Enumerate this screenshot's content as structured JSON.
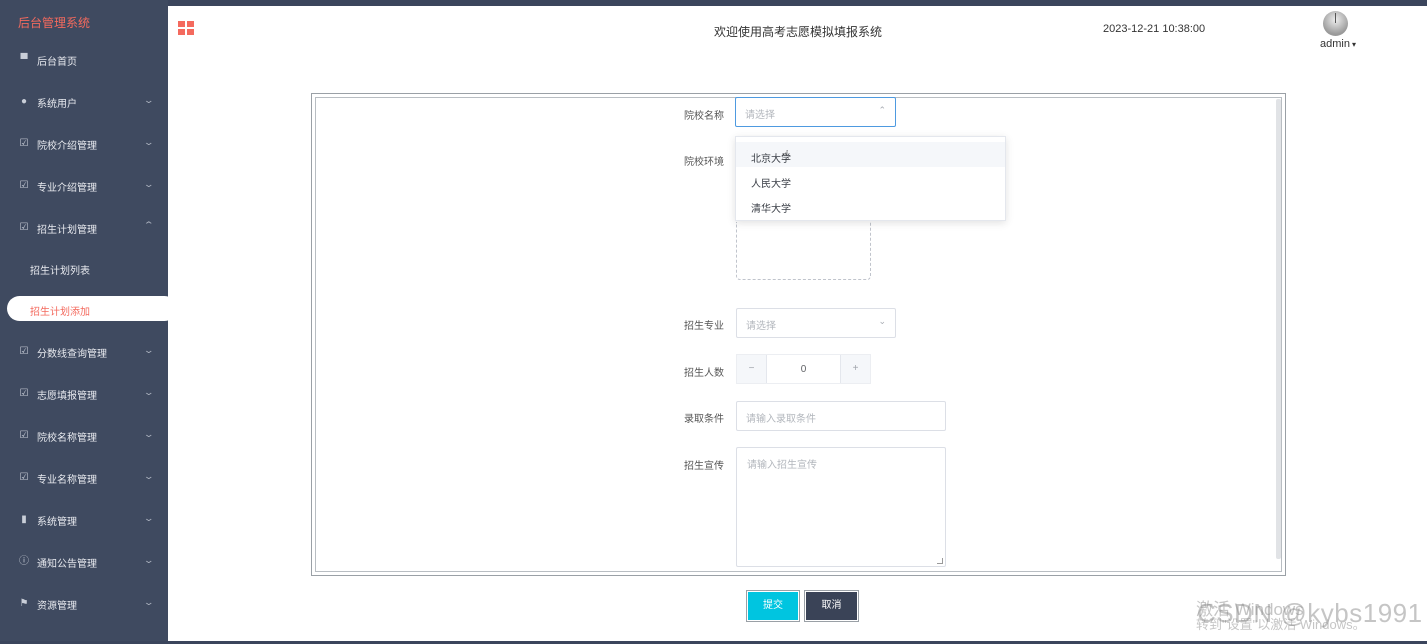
{
  "app": {
    "brand": "后台管理系统",
    "title": "欢迎使用高考志愿模拟填报系统",
    "datetime": "2023-12-21 10:38:00",
    "username": "admin",
    "accent_color": "#f46a5e",
    "sidebar_color": "#3f4a60"
  },
  "sidebar": {
    "items": [
      {
        "label": "后台首页",
        "icon": "monitor-icon"
      },
      {
        "label": "系统用户",
        "icon": "user-icon"
      },
      {
        "label": "院校介绍管理",
        "icon": "check-square-icon"
      },
      {
        "label": "专业介绍管理",
        "icon": "check-square-icon"
      },
      {
        "label": "招生计划管理",
        "icon": "check-square-icon",
        "expanded": true
      },
      {
        "label": "分数线查询管理",
        "icon": "check-square-icon"
      },
      {
        "label": "志愿填报管理",
        "icon": "check-square-icon"
      },
      {
        "label": "院校名称管理",
        "icon": "check-square-icon"
      },
      {
        "label": "专业名称管理",
        "icon": "check-square-icon"
      },
      {
        "label": "系统管理",
        "icon": "bar-chart-icon"
      },
      {
        "label": "通知公告管理",
        "icon": "info-icon"
      },
      {
        "label": "资源管理",
        "icon": "flag-icon"
      }
    ],
    "sub_items": [
      {
        "label": "招生计划列表",
        "active": false
      },
      {
        "label": "招生计划添加",
        "active": true
      }
    ]
  },
  "form": {
    "school_label": "院校名称",
    "school_placeholder": "请选择",
    "school_options": [
      "北京大学",
      "人民大学",
      "清华大学"
    ],
    "env_label": "院校环境",
    "major_label": "招生专业",
    "major_placeholder": "请选择",
    "count_label": "招生人数",
    "count_value": "0",
    "count_minus": "−",
    "count_plus": "+",
    "condition_label": "录取条件",
    "condition_placeholder": "请输入录取条件",
    "promo_label": "招生宣传",
    "promo_placeholder": "请输入招生宣传",
    "submit_label": "提交",
    "cancel_label": "取消"
  },
  "watermark": {
    "activate_title": "激活 Windows",
    "activate_sub": "转到\"设置\"以激活 Windows。",
    "csdn": "CSDN @kybs1991"
  }
}
